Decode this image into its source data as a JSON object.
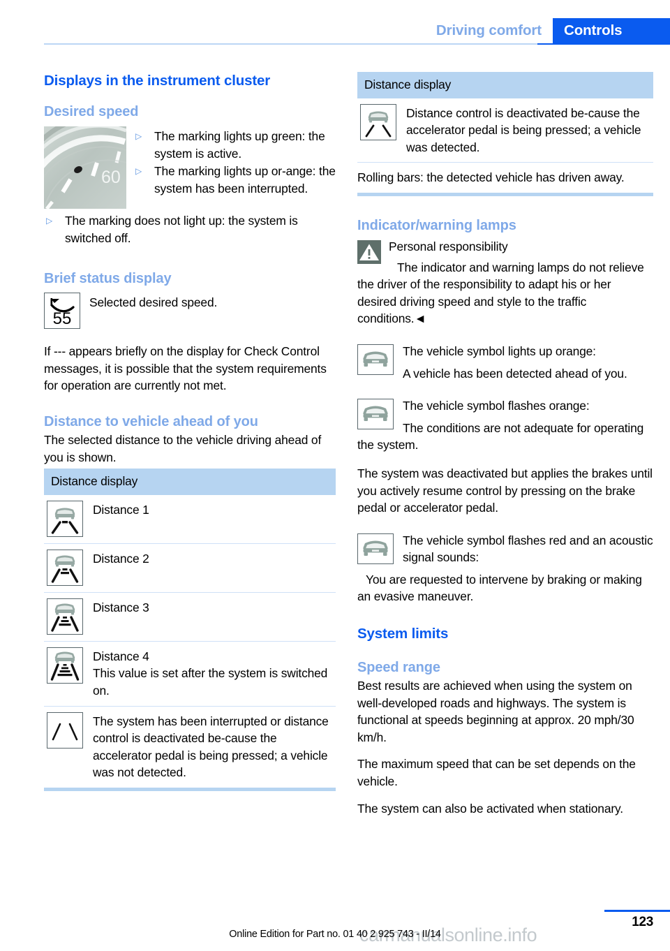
{
  "header": {
    "breadcrumb_secondary": "Driving comfort",
    "breadcrumb_primary": "Controls"
  },
  "left_column": {
    "main_heading": "Displays in the instrument cluster",
    "desired_speed": {
      "heading": "Desired speed",
      "gauge_label": "60",
      "bullets": [
        "The marking lights up green: the system is active.",
        "The marking lights up or-­ange: the system has been interrupted.",
        "The marking does not light up: the system is switched off."
      ],
      "bullet_glyph": "▷"
    },
    "brief_status": {
      "heading": "Brief status display",
      "icon_value": "55",
      "icon_caption": "Selected desired speed.",
      "paragraph": "If --- appears briefly on the display for Check Control messages, it is possible that the system requirements for operation are currently not met."
    },
    "distance_section": {
      "heading": "Distance to vehicle ahead of you",
      "intro": "The selected distance to the vehicle driving ahead of you is shown.",
      "table_header": "Distance display",
      "rows": [
        {
          "icon": "distance-1-icon",
          "bars": 1,
          "lines": [
            "Distance 1"
          ]
        },
        {
          "icon": "distance-2-icon",
          "bars": 2,
          "lines": [
            "Distance 2"
          ]
        },
        {
          "icon": "distance-3-icon",
          "bars": 3,
          "lines": [
            "Distance 3"
          ]
        },
        {
          "icon": "distance-4-icon",
          "bars": 4,
          "lines": [
            "Distance 4",
            "This value is set after the system is switched on."
          ]
        },
        {
          "icon": "distance-interrupted-icon",
          "bars": 0,
          "lines": [
            "The system has been interrupted or distance control is deactivated be-cause the accelerator pedal is being pressed; a vehicle was not detected."
          ]
        }
      ]
    }
  },
  "right_column": {
    "distance_table": {
      "table_header": "Distance display",
      "row_icon": "distance-deactivated-icon",
      "row_text": "Distance control is deactivated be-cause the accelerator pedal is being pressed; a vehicle was detected.",
      "note": "Rolling bars: the detected vehicle has driven away."
    },
    "indicator_lamps": {
      "heading": "Indicator/warning lamps",
      "warning_title": "Personal responsibility",
      "warning_body": "The indicator and warning lamps do not relieve the driver of the responsibility to adapt his or her desired driving speed and style to the traffic conditions.◄",
      "items": [
        {
          "icon": "vehicle-symbol-icon",
          "lead": "The vehicle symbol lights up orange:",
          "follow": "A vehicle has been detected ahead of you."
        },
        {
          "icon": "vehicle-symbol-icon",
          "lead": "The vehicle symbol flashes orange:",
          "follow": "The conditions are not adequate for operating the system."
        }
      ],
      "deactivation_paragraph": "The system was deactivated but applies the brakes until you actively resume control by pressing on the brake pedal or accelerator pedal.",
      "red_flash": {
        "icon": "vehicle-symbol-icon",
        "lead": "The vehicle symbol flashes red and an acoustic signal sounds:",
        "follow": "You are requested to intervene by braking or making an evasive maneuver."
      }
    },
    "system_limits": {
      "heading": "System limits",
      "sub_heading": "Speed range",
      "paragraphs": [
        "Best results are achieved when using the system on well-developed roads and highways. The system is functional at speeds beginning at approx. 20 mph/30 km/h.",
        "The maximum speed that can be set depends on the vehicle.",
        "The system can also be activated when stationary."
      ]
    }
  },
  "footer": {
    "edition_text": "Online Edition for Part no. 01 40 2 925 743 - II/14",
    "page_number": "123",
    "watermark": "carmanualsonline.info"
  },
  "colors": {
    "accent_blue": "#0a5bef",
    "light_blue": "#7fa9e8",
    "table_header_bg": "#b6d4f1",
    "rule_blue": "#cfe0f7",
    "icon_gray_green": "#8fa39d",
    "warn_box": "#5e6f6a"
  }
}
